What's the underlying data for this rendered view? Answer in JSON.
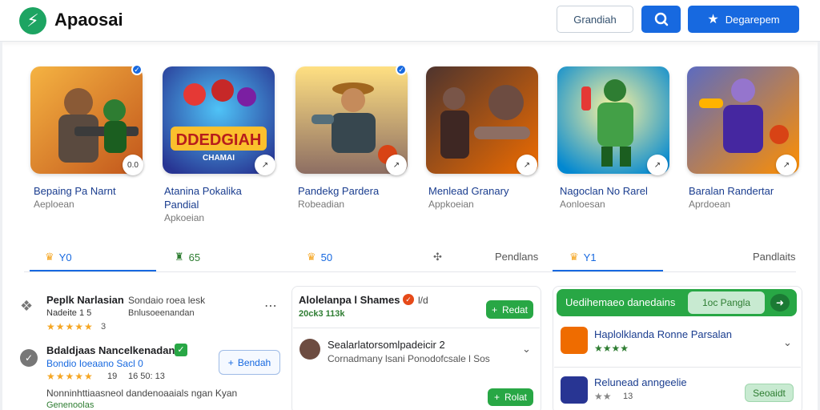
{
  "header": {
    "logo_glyph": "⚡",
    "app_name": "Apaosai",
    "outline_button": "Grandiah",
    "primary_button": "Degarepem"
  },
  "games": [
    {
      "title": "Bepaing Pa Narnt",
      "category": "Aeploean",
      "rating": "0.0",
      "verified": true
    },
    {
      "title": "Atanina Pokalika Pandial",
      "category": "Apkoeian",
      "rating": "",
      "verified": false
    },
    {
      "title": "Pandekg Pardera",
      "category": "Robeadian",
      "rating": "",
      "verified": true
    },
    {
      "title": "Menlead Granary",
      "category": "Appkoeian",
      "rating": "",
      "verified": false
    },
    {
      "title": "Nagoclan No Rarel",
      "category": "Aonloesan",
      "rating": "",
      "verified": false
    },
    {
      "title": "Baralan Randertar",
      "category": "Aprdoean",
      "rating": "",
      "verified": false
    }
  ],
  "card_art_text": {
    "line1": "DDEDGIAH",
    "line2": "CHAMAI"
  },
  "tabs": [
    {
      "label": "Y0",
      "icon": "crown-icon"
    },
    {
      "label": "65",
      "icon": "trophy-icon"
    },
    {
      "label": "50",
      "icon": "crown-icon"
    },
    {
      "label": "",
      "icon": "puzzle-icon"
    },
    {
      "label": "Pendlans",
      "icon": ""
    },
    {
      "label": "Y1",
      "icon": "crown-icon"
    },
    {
      "label": "Pandlaits",
      "icon": ""
    }
  ],
  "left_panel": {
    "item1": {
      "title": "Peplk Narlasian",
      "subtitle": "Nadeite 1 5",
      "desc1": "Sondaio roea lesk",
      "desc2": "Bnlusoeenandan",
      "stars": "★★★★★",
      "count": "3"
    },
    "item2": {
      "title": "Bdaldjaas Nancelkenadans",
      "subtitle": "Bondio Ioeaano Sacl 0",
      "stars": "★★★★★",
      "num1": "19",
      "num2": "16 50: 13",
      "desc": "Nonninhttiaasneol dandenoaaials ngan Kyan",
      "tag": "Genenoolas"
    },
    "follow_button": "Bendah"
  },
  "middle_panel": {
    "title": "Alolelanpa l Shames",
    "title_suffix": "l/d",
    "meta": "20ck3 113k",
    "button1": "Redat",
    "user_name": "Sealarlatorsomlpadeicir 2",
    "user_desc": "Cornadmany lsani Ponodofcsale l Sos",
    "button2": "Rolat"
  },
  "right_panel": {
    "banner_text": "Uedihemaeo danedains",
    "banner_button": "1oc Pangla",
    "item1": {
      "title": "Haplolklanda Ronne Parsalan",
      "stars": "★★★★"
    },
    "item2": {
      "title": "Relunead anngeelie",
      "stars": "★★",
      "count": "13",
      "button": "Seoaidt"
    }
  },
  "colors": {
    "accent": "#1769e0",
    "brand": "#1da462",
    "success": "#28a745",
    "star": "#f5a623",
    "title_link": "#1a3d8f"
  }
}
